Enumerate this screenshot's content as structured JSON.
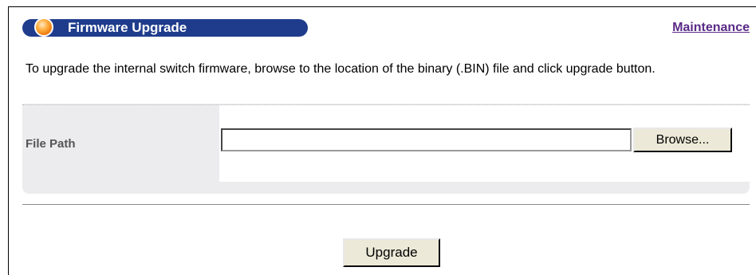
{
  "header": {
    "title": "Firmware Upgrade",
    "maintenance_link": "Maintenance",
    "accent_color": "#1f3c8c",
    "link_color": "#5a2a86"
  },
  "description": "To upgrade the internal switch firmware, browse to the location of the binary (.BIN) file and click upgrade button.",
  "form": {
    "file_path_label": "File Path",
    "file_path_value": "",
    "browse_label": "Browse..."
  },
  "actions": {
    "upgrade_label": "Upgrade"
  }
}
